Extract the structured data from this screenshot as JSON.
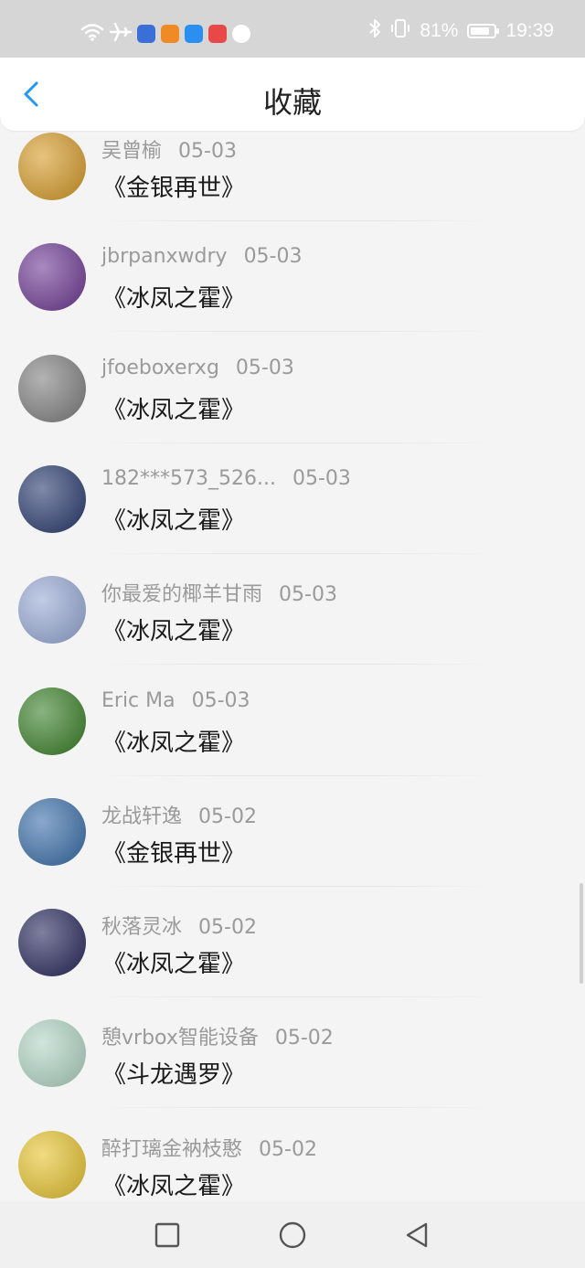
{
  "status_bar": {
    "battery_percent": "81%",
    "battery_level": 0.81,
    "time": "19:39",
    "left_icons": [
      "wifi-icon",
      "airplane-icon",
      "music-app-icon",
      "video-app-icon",
      "search-app-icon",
      "store-app-icon",
      "ball-app-icon"
    ],
    "right_icons": [
      "bluetooth-icon",
      "vibrate-icon",
      "battery-icon"
    ],
    "background": "#d6d6d6"
  },
  "header": {
    "title": "收藏",
    "back_icon": "chevron-left-icon",
    "accent": "#2196f3"
  },
  "favorites": [
    {
      "user": "吴曾榆",
      "date": "05-03",
      "title": "《金银再世》",
      "avatar_color": "#d9a33a"
    },
    {
      "user": "jbrpanxwdry",
      "date": "05-03",
      "title": "《冰凤之霍》",
      "avatar_color": "#7a4a9c"
    },
    {
      "user": "jfoeboxerxg",
      "date": "05-03",
      "title": "《冰凤之霍》",
      "avatar_color": "#8a8a8a"
    },
    {
      "user": "182***573_526...",
      "date": "05-03",
      "title": "《冰凤之霍》",
      "avatar_color": "#3a4a7a"
    },
    {
      "user": "你最爱的椰羊甘雨",
      "date": "05-03",
      "title": "《冰凤之霍》",
      "avatar_color": "#9fb0d8"
    },
    {
      "user": "Eric Ma",
      "date": "05-03",
      "title": "《冰凤之霍》",
      "avatar_color": "#4a8a3a"
    },
    {
      "user": "龙战轩逸",
      "date": "05-02",
      "title": "《金银再世》",
      "avatar_color": "#4a7ab0"
    },
    {
      "user": "秋落灵冰",
      "date": "05-02",
      "title": "《冰凤之霍》",
      "avatar_color": "#3a3a6a"
    },
    {
      "user": "憩vrbox智能设备",
      "date": "05-02",
      "title": "《斗龙遇罗》",
      "avatar_color": "#b7d8c8"
    },
    {
      "user": "醉打璃金衲枝憨",
      "date": "05-02",
      "title": "《冰凤之霍》",
      "avatar_color": "#e8c840"
    }
  ],
  "nav_bar": {
    "buttons": [
      "recent-apps-icon",
      "home-icon",
      "back-icon"
    ]
  }
}
